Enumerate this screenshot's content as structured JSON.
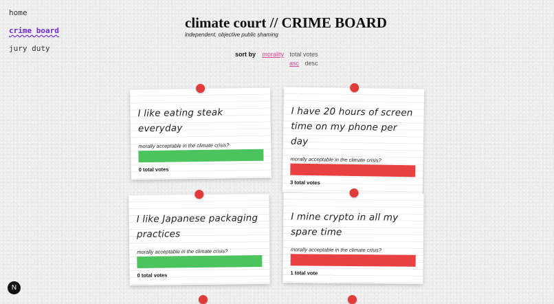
{
  "nav": {
    "home": "home",
    "crime_board": "crime board",
    "jury_duty": "jury duty"
  },
  "header": {
    "title": "climate court // CRIME BOARD",
    "subtitle": "independent, objective public shaming"
  },
  "sort": {
    "label": "sort by",
    "options": [
      "morality",
      "total votes"
    ],
    "order": [
      "asc",
      "desc"
    ],
    "active_option": "morality",
    "active_order": "asc"
  },
  "cards": [
    {
      "text": "I like eating steak everyday",
      "question": "morally acceptable in the climate crisis?",
      "verdict": "acceptable",
      "votes": "0 total votes"
    },
    {
      "text": "I have 20 hours of screen time on my phone per day",
      "question": "morally acceptable in the climate crisis?",
      "verdict": "unacceptable",
      "votes": "3 total votes"
    },
    {
      "text": "I like Japanese packaging practices",
      "question": "morally acceptable in the climate crisis?",
      "verdict": "acceptable",
      "votes": "0 total votes"
    },
    {
      "text": "I mine crypto in all my spare time",
      "question": "morally acceptable in the climate crisis?",
      "verdict": "unacceptable",
      "votes": "1 total vote"
    }
  ],
  "colors": {
    "acceptable": "#4cc45e",
    "unacceptable": "#e94141",
    "pin": "#e03a3a",
    "accent": "#d9449b",
    "nav_active": "#6d28d9"
  },
  "logo": {
    "letter": "N"
  }
}
